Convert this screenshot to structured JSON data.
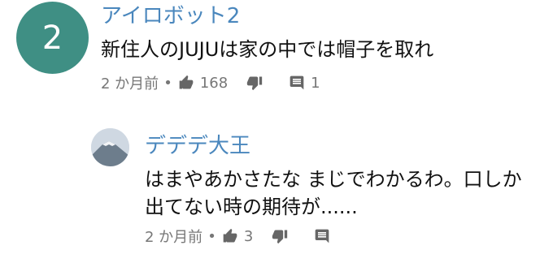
{
  "comment": {
    "rank": "2",
    "author": "アイロボット2",
    "text": "新住人のJUJUは家の中では帽子を取れ",
    "time": "2 か月前",
    "likes": "168",
    "replies": "1"
  },
  "reply": {
    "author": "デデデ大王",
    "text_line1": "はまやあかさたな まじでわかるわ。口しか",
    "text_line2": "出てない時の期待が......",
    "time": "2 か月前",
    "likes": "3"
  },
  "icons": {
    "like": "thumbs-up-icon",
    "dislike": "thumbs-down-icon",
    "comment": "comment-icon"
  }
}
